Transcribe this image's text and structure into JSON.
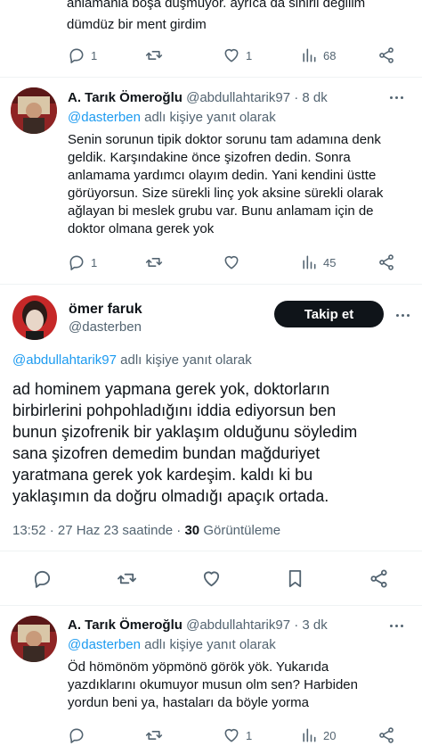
{
  "tweet_prev": {
    "text_line1": "anlamanla boşa düşmüyor. ayrıca da sinirli değilim",
    "text_line2": "dümdüz bir ment girdim",
    "replies": "1",
    "likes": "1",
    "views": "68"
  },
  "tweet_reply1": {
    "author_name": "A. Tarık Ömeroğlu",
    "handle": "@abdullahtarik97",
    "time": "· 8 dk",
    "reply_to_user": "@dasterben",
    "reply_to_suffix": "adlı kişiye yanıt olarak",
    "lines": [
      "Senin sorunun tipik doktor sorunu tam adamına denk",
      "geldik. Karşındakine önce şizofren dedin. Sonra",
      "anlamama yardımcı olayım dedin. Yani kendini üstte",
      "görüyorsun. Size sürekli linç yok aksine sürekli olarak",
      "ağlayan bi meslek grubu var. Bunu anlamam için de",
      "doktor olmana gerek yok"
    ],
    "replies": "1",
    "views": "45"
  },
  "main_tweet": {
    "author_name": "ömer faruk",
    "handle": "@dasterben",
    "follow_label": "Takip et",
    "reply_to_user": "@abdullahtarik97",
    "reply_to_suffix": "adlı kişiye yanıt olarak",
    "lines": [
      "ad hominem yapmana gerek yok, doktorların",
      "birbirlerini pohpohladığını iddia ediyorsun ben",
      "bunun şizofrenik bir yaklaşım olduğunu söyledim",
      "sana şizofren demedim bundan mağduriyet",
      "yaratmana gerek yok kardeşim. kaldı ki bu",
      "yaklaşımın da doğru olmadığı apaçık ortada."
    ],
    "timestamp": "13:52 · 27 Haz 23 saatinde ·",
    "views_count": "30",
    "views_label": "Görüntüleme"
  },
  "tweet_reply2": {
    "author_name": "A. Tarık Ömeroğlu",
    "handle": "@abdullahtarik97",
    "time": "· 3 dk",
    "reply_to_user": "@dasterben",
    "reply_to_suffix": "adlı kişiye yanıt olarak",
    "lines": [
      "Öd hömönöm yöpmönö görök yök. Yukarıda",
      "yazdıklarını okumuyor musun olm sen? Harbiden",
      "yordun beni ya, hastaları da böyle yorma"
    ],
    "replies": "",
    "likes": "1",
    "views": "20"
  },
  "colors": {
    "text": "#0f1419",
    "muted": "#536471",
    "link": "#1d9bf0",
    "divider": "#eff3f4",
    "button_bg": "#0f1419"
  },
  "icons": [
    "reply-icon",
    "retweet-icon",
    "like-icon",
    "views-icon",
    "share-icon",
    "bookmark-icon",
    "more-icon"
  ]
}
